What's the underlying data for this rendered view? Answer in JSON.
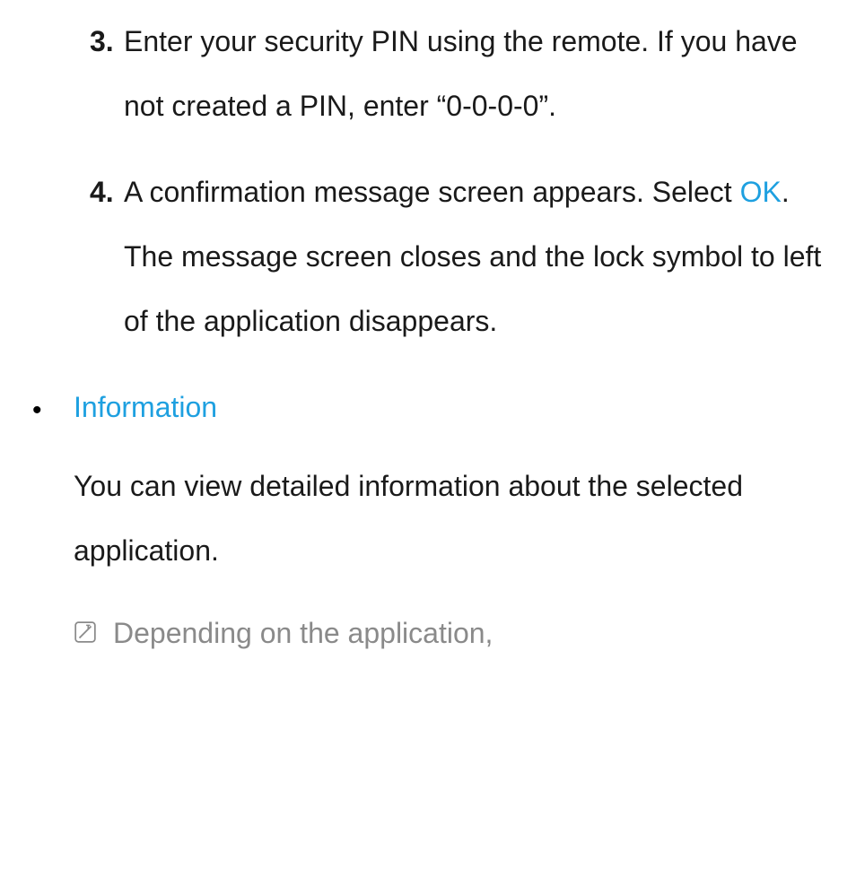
{
  "steps": {
    "three": {
      "num": "3.",
      "text": "Enter your security PIN using the remote. If you have not created a PIN, enter “0-0-0-0”."
    },
    "four": {
      "num": "4.",
      "pre": "A confirmation message screen appears. Select ",
      "link": "OK",
      "post": ". The message screen closes and the lock symbol to left of the application disappears."
    }
  },
  "section": {
    "title": "Information",
    "body": "You can view detailed information about the selected application."
  },
  "note": {
    "text": "Depending on the application,"
  }
}
